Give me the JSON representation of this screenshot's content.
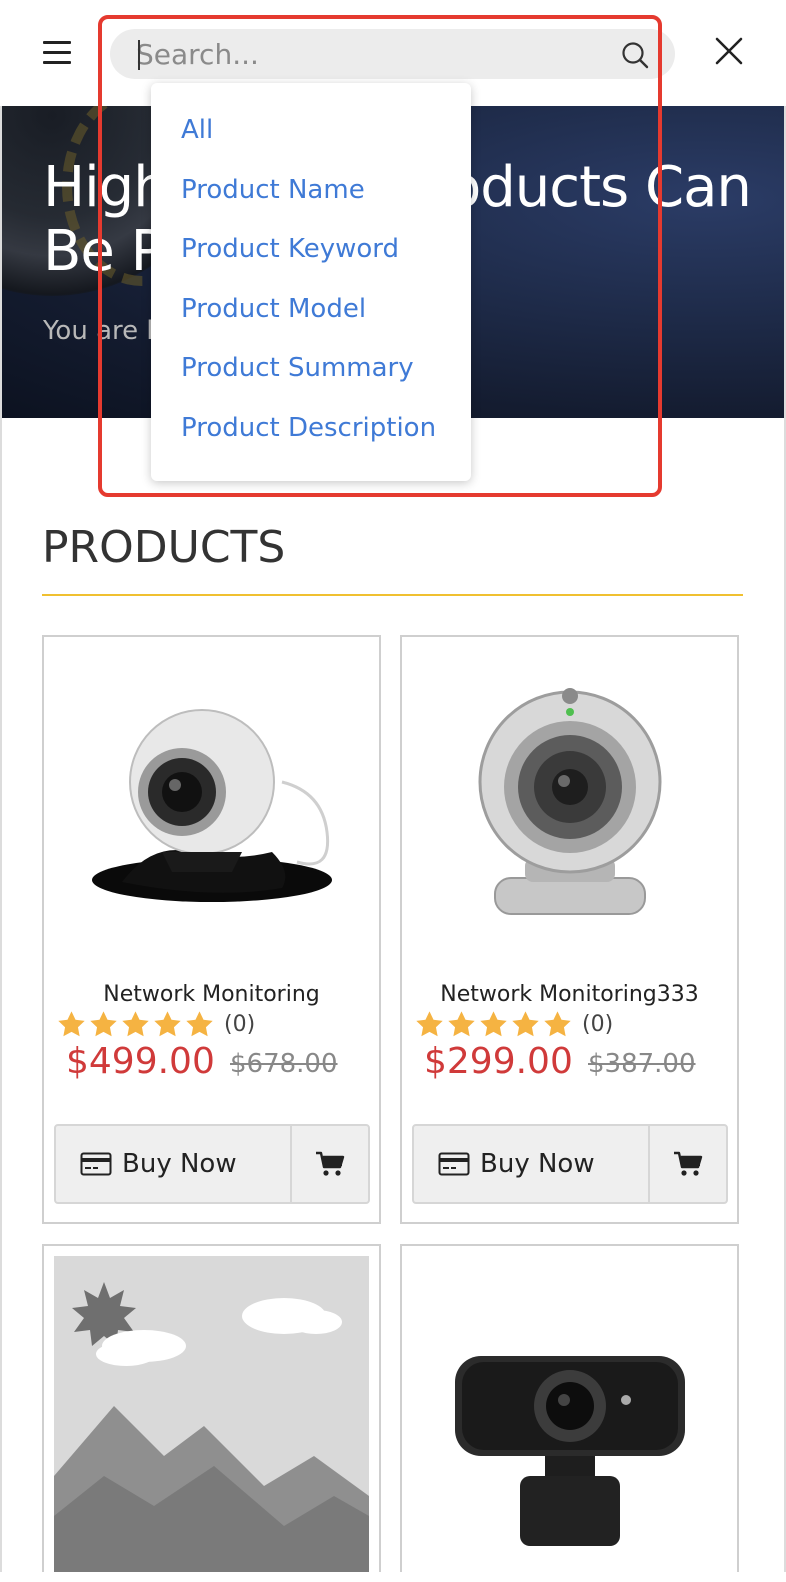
{
  "header": {
    "search_placeholder": "Search..."
  },
  "hero": {
    "title": "High Quality Products Can Be P",
    "subtitle": "You are h"
  },
  "search_dropdown": {
    "options": [
      "All",
      "Product Name",
      "Product Keyword",
      "Product Model",
      "Product Summary",
      "Product Description"
    ]
  },
  "products_section": {
    "title": "PRODUCTS",
    "items": [
      {
        "name": "Network Monitoring",
        "rating_count": "(0)",
        "price": "$499.00",
        "old_price": "$678.00",
        "buy_label": "Buy Now",
        "stars": 5
      },
      {
        "name": "Network Monitoring333",
        "rating_count": "(0)",
        "price": "$299.00",
        "old_price": "$387.00",
        "buy_label": "Buy Now",
        "stars": 5
      }
    ]
  },
  "colors": {
    "accent_blue": "#3f7ad6",
    "price_red": "#d03a3a",
    "star_gold": "#f5b342",
    "highlight_red": "#e53a2f",
    "section_underline": "#f0c030"
  }
}
